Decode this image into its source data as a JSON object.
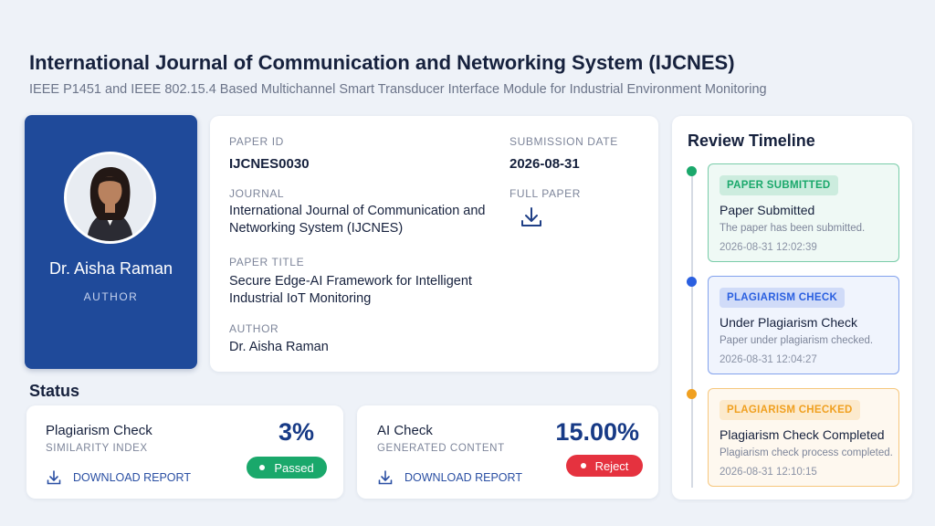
{
  "header": {
    "title": "International Journal of Communication and Networking System (IJCNES)",
    "subtitle": "IEEE P1451 and IEEE 802.15.4 Based Multichannel Smart Transducer Interface Module for Industrial Environment Monitoring"
  },
  "author_card": {
    "name": "Dr. Aisha Raman",
    "role": "AUTHOR",
    "avatar_icon": "author-photo"
  },
  "details": {
    "paper_id_label": "PAPER ID",
    "paper_id": "IJCNES0030",
    "submission_date_label": "SUBMISSION DATE",
    "submission_date": "2026-08-31",
    "journal_label": "JOURNAL",
    "journal_line1": "International Journal of Communication and",
    "journal_line2": "Networking System (IJCNES)",
    "full_paper_label": "FULL PAPER",
    "full_paper_icon": "download-icon",
    "paper_title_label": "PAPER TITLE",
    "paper_title_line1": "Secure Edge-AI Framework for Intelligent",
    "paper_title_line2": "Industrial IoT Monitoring",
    "author_label": "AUTHOR",
    "author": "Dr. Aisha Raman"
  },
  "status": {
    "heading": "Status",
    "plagiarism": {
      "title": "Plagiarism Check",
      "subtitle": "SIMILARITY INDEX",
      "value": "3%",
      "badge": "Passed",
      "badge_color": "#1aa86b",
      "link": "DOWNLOAD REPORT"
    },
    "ai": {
      "title": "AI Check",
      "subtitle": "GENERATED CONTENT",
      "value": "15.00%",
      "badge": "Reject",
      "badge_color": "#e5323f",
      "link": "DOWNLOAD REPORT"
    }
  },
  "timeline": {
    "title": "Review Timeline",
    "events": [
      {
        "badge": "PAPER SUBMITTED",
        "heading": "Paper Submitted",
        "description": "The paper has been submitted.",
        "time": "2026-08-31 12:02:39",
        "color": "#1aa86b"
      },
      {
        "badge": "PLAGIARISM CHECK",
        "heading": "Under Plagiarism Check",
        "description": "Paper under plagiarism checked.",
        "time": "2026-08-31 12:04:27",
        "color": "#2a5fe0"
      },
      {
        "badge": "PLAGIARISM CHECKED",
        "heading": "Plagiarism Check Completed",
        "description": "Plagiarism check process completed.",
        "time": "2026-08-31 12:10:15",
        "color": "#f0a020"
      }
    ]
  }
}
